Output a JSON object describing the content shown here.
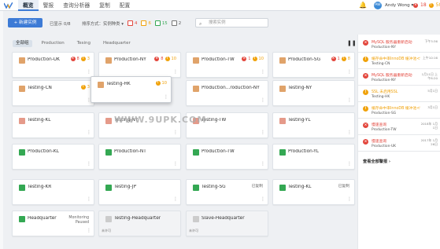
{
  "nav": {
    "items": [
      "概览",
      "警报",
      "查询分析器",
      "复制",
      "配置"
    ],
    "active": "概览"
  },
  "header": {
    "user_initials": "AW",
    "user_name": "Andy Wong",
    "critical_count": "18",
    "warning_count": "50"
  },
  "toolbar": {
    "new_instance": "+ 新建实例",
    "showing": "已显示 0/8",
    "sort": "排序方式：实例种类",
    "counts": [
      {
        "value": "4",
        "color": "#e3463c"
      },
      {
        "value": "6",
        "color": "#f0a20b"
      },
      {
        "value": "15",
        "color": "#34a853"
      },
      {
        "value": "2",
        "color": "#777777"
      }
    ],
    "search_placeholder": "搜索实例"
  },
  "filters": [
    "全部组",
    "Production",
    "Tesing",
    "Headquarter"
  ],
  "cards": [
    {
      "name": "Production-UK",
      "icon_color": "#e0a36a",
      "red": "8",
      "orange": "3"
    },
    {
      "name": "Production-NY",
      "icon_color": "#e0a36a",
      "red": "8",
      "orange": "10"
    },
    {
      "name": "Production-TW",
      "icon_color": "#e0a36a",
      "red": "1",
      "orange": "10"
    },
    {
      "name": "Production-SG",
      "icon_color": "#e0a36a",
      "red": "1",
      "orange": "8"
    },
    {
      "name": "Testing-HK",
      "icon_color": "#e0a36a",
      "orange": "10"
    },
    {
      "name": "Testing-CN",
      "icon_color": "#e0a36a",
      "orange": "3"
    },
    {
      "name": "Production...roduction-NY",
      "icon_color": "#e0a36a"
    },
    {
      "name": "Testing-NY",
      "icon_color": "#e0a36a"
    },
    {
      "name": "Testing-KL",
      "icon_color": "#e59a8a"
    },
    {
      "name": "Testing-NY",
      "icon_color": "#e59a8a"
    },
    {
      "name": "Testing-TW",
      "icon_color": "#e59a8a"
    },
    {
      "name": "Testing-YL",
      "icon_color": "#e59a8a"
    },
    {
      "name": "Production-KL",
      "icon_color": "#34a853"
    },
    {
      "name": "Production-NT",
      "icon_color": "#34a853"
    },
    {
      "name": "Production-TW",
      "icon_color": "#34a853"
    },
    {
      "name": "Production-YL",
      "icon_color": "#34a853"
    },
    {
      "name": "Testing-KR",
      "icon_color": "#34a853"
    },
    {
      "name": "Testing-JP",
      "icon_color": "#34a853"
    },
    {
      "name": "Testing-SG",
      "icon_color": "#34a853",
      "status": "已复制"
    },
    {
      "name": "Testing-KL",
      "icon_color": "#34a853",
      "status": "已复制"
    },
    {
      "name": "Headquarter",
      "icon_color": "#34a853",
      "status": "Monitoring Paused"
    },
    {
      "name": "Testing-Headquarter",
      "icon_color": "#cccccc",
      "sub": "未许可"
    },
    {
      "name": "Slave-Headquarter",
      "icon_color": "#cccccc",
      "sub": "未许可"
    }
  ],
  "alerts": [
    {
      "type": "red",
      "title": "MySQL 服务器重新启动",
      "subtitle": "Production-NY",
      "time": "下午3:36"
    },
    {
      "type": "orange",
      "title": "缓存命中率InnoDB 缓冲池<90%",
      "subtitle": "Testing-CN",
      "time": "上午10:16"
    },
    {
      "type": "red",
      "title": "MySQL 服务器重新启动",
      "subtitle": "Production-NY",
      "time": "1月11日 上午8:20"
    },
    {
      "type": "orange",
      "title": "SSL 未启用SSL",
      "subtitle": "Testing-HK",
      "time": "5月1日"
    },
    {
      "type": "orange",
      "title": "缓存命中率InnoDB 缓冲池<90%",
      "subtitle": "Production-SG",
      "time": "3月1日"
    },
    {
      "type": "red",
      "title": "慢速查询",
      "subtitle": "Production-TW",
      "time": "2018年 1月1日"
    },
    {
      "type": "red",
      "title": "慢速查询",
      "subtitle": "Production-UK",
      "time": "2017年 1月26日"
    }
  ],
  "alerts_link": "查看全部警报 ›",
  "watermark": "WWW.9UPK.COM"
}
